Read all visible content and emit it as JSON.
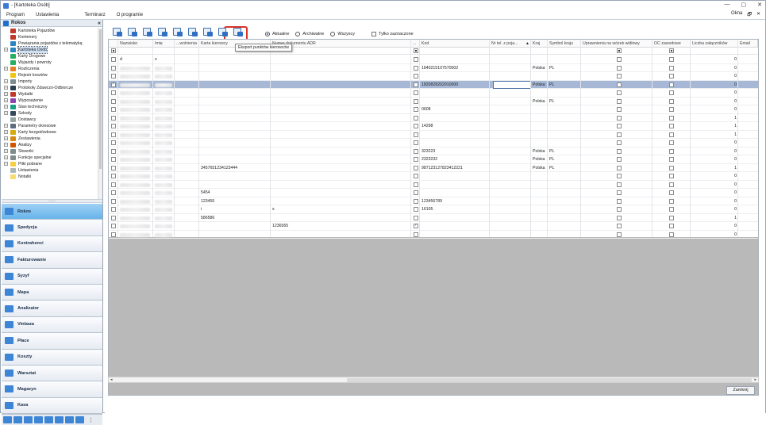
{
  "window": {
    "title": "- [Kartoteka Osób]",
    "controls": [
      "—",
      "▢",
      "✕"
    ]
  },
  "menu": {
    "items": [
      "Program",
      "Ustawienia",
      "Terminarz",
      "O programie"
    ],
    "right": [
      "Okna",
      "🗗",
      "✕"
    ]
  },
  "left_panel": {
    "title": "Rokos",
    "collapse": "«",
    "tree": [
      {
        "label": "Kartoteka Pojazdów",
        "color": "#c0392b",
        "exp": false
      },
      {
        "label": "Kontenery",
        "color": "#c0392b",
        "exp": false
      },
      {
        "label": "Powiązania pojazdów z telematyką",
        "color": "#2e86c1",
        "exp": false
      },
      {
        "label": "Kartoteka Osób",
        "color": "#2e86c1",
        "exp": true,
        "selected": true
      },
      {
        "label": "Karty Drogowe",
        "color": "#27ae60",
        "exp": false
      },
      {
        "label": "Wyjazdy i powroty",
        "color": "#27ae60",
        "exp": false
      },
      {
        "label": "Rozliczenia",
        "color": "#e67e22",
        "exp": true
      },
      {
        "label": "Rejestr kosztów",
        "color": "#f1c40f",
        "exp": false
      },
      {
        "label": "Importy",
        "color": "#7f8c8d",
        "exp": true
      },
      {
        "label": "Protokoły Zdawczo-Odbiorcze",
        "color": "#2c3e50",
        "exp": true
      },
      {
        "label": "Wydatki",
        "color": "#c0392b",
        "exp": true
      },
      {
        "label": "Wyposażenie",
        "color": "#8e44ad",
        "exp": true
      },
      {
        "label": "Stan techniczny",
        "color": "#16a085",
        "exp": true
      },
      {
        "label": "Szkody",
        "color": "#34495e",
        "exp": true
      },
      {
        "label": "Dostawcy",
        "color": "#95a5a6",
        "exp": false
      },
      {
        "label": "Parametry okresowe",
        "color": "#5d6d7e",
        "exp": true
      },
      {
        "label": "Karty bezgotówkowe",
        "color": "#d4ac0d",
        "exp": true
      },
      {
        "label": "Zestawienia",
        "color": "#d68910",
        "exp": true
      },
      {
        "label": "Analizy",
        "color": "#d35400",
        "exp": true
      },
      {
        "label": "Słowniki",
        "color": "#7f8c8d",
        "exp": true
      },
      {
        "label": "Funkcje specjalne",
        "color": "#7f8c8d",
        "exp": true
      },
      {
        "label": "Pliki pobrane",
        "color": "#f4d03f",
        "exp": true
      },
      {
        "label": "Ustawienia",
        "color": "#aab7b8",
        "exp": false
      },
      {
        "label": "Notatki",
        "color": "#f7dc6f",
        "exp": false
      }
    ],
    "splitter": "........",
    "nav": [
      {
        "label": "Rokos",
        "active": true
      },
      {
        "label": "Spedycja"
      },
      {
        "label": "Kontrahenci"
      },
      {
        "label": "Fakturowanie"
      },
      {
        "label": "Syzyf"
      },
      {
        "label": "Mapa"
      },
      {
        "label": "Analizator"
      },
      {
        "label": "Vinbaza"
      },
      {
        "label": "Płace"
      },
      {
        "label": "Koszty"
      },
      {
        "label": "Warsztat"
      },
      {
        "label": "Magazyn"
      },
      {
        "label": "Kasa"
      }
    ],
    "nav_more": "⋮"
  },
  "toolbar": {
    "filter_options": [
      {
        "label": "Aktualne",
        "checked": true
      },
      {
        "label": "Archiwalne",
        "checked": false
      },
      {
        "label": "Wszyscy",
        "checked": false
      }
    ],
    "only_selected_label": "Tylko zaznaczone",
    "tooltip": "Eksport punktów kierowców"
  },
  "grid": {
    "columns": [
      "",
      "Nazwisko",
      "Imię",
      "...wolnienia",
      "Karta kierowcy",
      "Numer dokumentu ADR",
      "...",
      "Kod",
      "Nr tel. z poja...",
      "Kraj",
      "Symbol kraju",
      "Uprawnienia na wózek widłowy",
      "OC zawodowe",
      "Liczba załączników",
      "Email"
    ],
    "sort_indicator": "▲",
    "rows": [
      {
        "nazwisko": "d",
        "imie": "s",
        "karta": "",
        "adr": "",
        "kod": "",
        "kraj": "",
        "symbol": "",
        "zal": "0",
        "blur": false
      },
      {
        "nazwisko": "",
        "imie": "",
        "karta": "",
        "adr": "",
        "kod": "1840215107570002",
        "kraj": "Polska",
        "symbol": "PL",
        "zal": "0",
        "blur": true
      },
      {
        "nazwisko": "",
        "imie": "",
        "karta": "",
        "adr": "",
        "kod": "",
        "kraj": "",
        "symbol": "",
        "zal": "0",
        "blur": true
      },
      {
        "nazwisko": "",
        "imie": "",
        "karta": "",
        "adr": "",
        "kod": "1820828202910000",
        "kraj": "Polska",
        "symbol": "PL",
        "zal": "0",
        "blur": true,
        "selected": true
      },
      {
        "nazwisko": "",
        "imie": "",
        "karta": "",
        "adr": "",
        "kod": "",
        "kraj": "",
        "symbol": "",
        "zal": "0",
        "blur": true
      },
      {
        "nazwisko": "",
        "imie": "",
        "karta": "",
        "adr": "",
        "kod": "",
        "kraj": "Polska",
        "symbol": "PL",
        "zal": "0",
        "blur": true
      },
      {
        "nazwisko": "",
        "imie": "",
        "karta": "",
        "adr": "",
        "kod": "0608",
        "kraj": "",
        "symbol": "",
        "zal": "0",
        "blur": true
      },
      {
        "nazwisko": "",
        "imie": "",
        "karta": "",
        "adr": "",
        "kod": "",
        "kraj": "",
        "symbol": "",
        "zal": "1",
        "blur": true
      },
      {
        "nazwisko": "",
        "imie": "",
        "karta": "",
        "adr": "",
        "kod": "14298",
        "kraj": "",
        "symbol": "",
        "zal": "1",
        "blur": true
      },
      {
        "nazwisko": "",
        "imie": "",
        "karta": "",
        "adr": "",
        "kod": "",
        "kraj": "",
        "symbol": "",
        "zal": "1",
        "blur": true
      },
      {
        "nazwisko": "",
        "imie": "",
        "karta": "",
        "adr": "",
        "kod": "",
        "kraj": "",
        "symbol": "",
        "zal": "0",
        "blur": true
      },
      {
        "nazwisko": "",
        "imie": "",
        "karta": "",
        "adr": "",
        "kod": "323223",
        "kraj": "Polska",
        "symbol": "PL",
        "zal": "0",
        "blur": true
      },
      {
        "nazwisko": "",
        "imie": "",
        "karta": "",
        "adr": "",
        "kod": "2323232",
        "kraj": "Polska",
        "symbol": "PL",
        "zal": "0",
        "blur": true
      },
      {
        "nazwisko": "",
        "imie": "",
        "karta": "3457651234123444",
        "adr": "",
        "kod": "987123127823412221",
        "kraj": "Polska",
        "symbol": "PL",
        "zal": "1",
        "blur": true
      },
      {
        "nazwisko": "",
        "imie": "",
        "karta": "",
        "adr": "",
        "kod": "",
        "kraj": "",
        "symbol": "",
        "zal": "0",
        "blur": true
      },
      {
        "nazwisko": "",
        "imie": "",
        "karta": "",
        "adr": "",
        "kod": "",
        "kraj": "",
        "symbol": "",
        "zal": "0",
        "blur": true
      },
      {
        "nazwisko": "",
        "imie": "",
        "karta": "5454",
        "adr": "",
        "kod": "",
        "kraj": "",
        "symbol": "",
        "zal": "0",
        "blur": true
      },
      {
        "nazwisko": "",
        "imie": "",
        "karta": "123455",
        "adr": "",
        "kod": "123456789",
        "kraj": "",
        "symbol": "",
        "zal": "0",
        "blur": true
      },
      {
        "nazwisko": "",
        "imie": "",
        "karta": "i",
        "adr": "s",
        "kod": "16105",
        "kraj": "",
        "symbol": "",
        "zal": "0",
        "blur": true
      },
      {
        "nazwisko": "",
        "imie": "",
        "karta": "586586",
        "adr": "",
        "kod": "",
        "kraj": "",
        "symbol": "",
        "zal": "1",
        "blur": true
      },
      {
        "nazwisko": "",
        "imie": "",
        "karta": "",
        "adr": "1236565",
        "kod": "",
        "kraj": "",
        "symbol": "",
        "zal": "0",
        "blur": true,
        "kod_checked": true
      },
      {
        "nazwisko": "",
        "imie": "",
        "karta": "",
        "adr": "",
        "kod": "",
        "kraj": "",
        "symbol": "",
        "zal": "0",
        "blur": true
      }
    ]
  },
  "footer": {
    "close_label": "Zamknij",
    "scroll_left": "◂",
    "scroll_right": "▸"
  }
}
